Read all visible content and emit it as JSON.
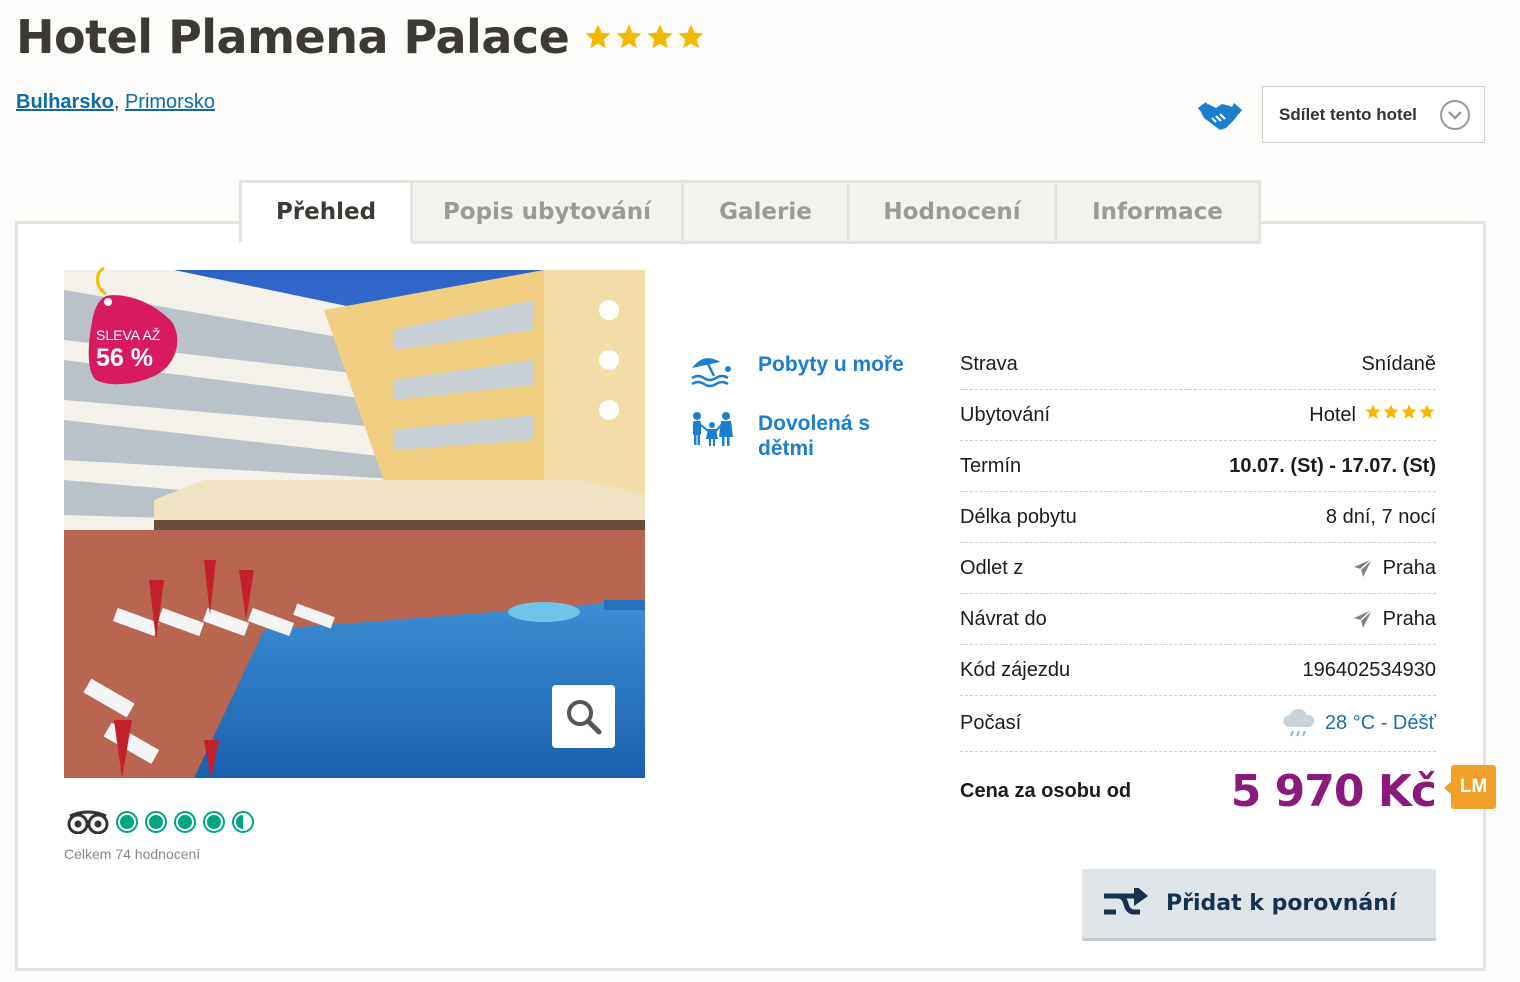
{
  "hotel": {
    "name": "Hotel Plamena Palace",
    "stars": 4
  },
  "breadcrumb": {
    "country": "Bulharsko",
    "separator": ",",
    "city": "Primorsko"
  },
  "share": {
    "label": "Sdílet tento hotel"
  },
  "tabs": [
    {
      "label": "Přehled",
      "active": true
    },
    {
      "label": "Popis ubytování",
      "active": false
    },
    {
      "label": "Galerie",
      "active": false
    },
    {
      "label": "Hodnocení",
      "active": false
    },
    {
      "label": "Informace",
      "active": false
    }
  ],
  "sale": {
    "line1": "SLEVA AŽ",
    "line2": "56 %"
  },
  "tripadvisor": {
    "rating": 4.5,
    "count_text": "Celkem 74 hodnocení"
  },
  "features": [
    {
      "icon": "beach-umbrella-icon",
      "label": "Pobyty u moře"
    },
    {
      "icon": "family-icon",
      "label": "Dovolená s dětmi"
    }
  ],
  "info": {
    "meal": {
      "label": "Strava",
      "value": "Snídaně"
    },
    "accommodation": {
      "label": "Ubytování",
      "value": "Hotel",
      "stars": 4
    },
    "term": {
      "label": "Termín",
      "value": "10.07. (St) - 17.07. (St)"
    },
    "length": {
      "label": "Délka pobytu",
      "value": "8 dní, 7 nocí"
    },
    "departure": {
      "label": "Odlet z",
      "value": "Praha"
    },
    "return": {
      "label": "Návrat do",
      "value": "Praha"
    },
    "code": {
      "label": "Kód zájezdu",
      "value": "196402534930"
    },
    "weather": {
      "label": "Počasí",
      "value": "28 °C - Déšť"
    }
  },
  "price": {
    "label": "Cena za osobu od",
    "value": "5 970 Kč",
    "badge": "LM"
  },
  "compare": {
    "label": "Přidat k porovnání"
  },
  "colors": {
    "star": "#f5b800",
    "link": "#0f6aa8",
    "accent_blue": "#1a7fcf",
    "price": "#8a1a7b",
    "sale_tag": "#d81b5f",
    "lm_badge": "#f1a02a",
    "tripadvisor": "#00a680"
  }
}
